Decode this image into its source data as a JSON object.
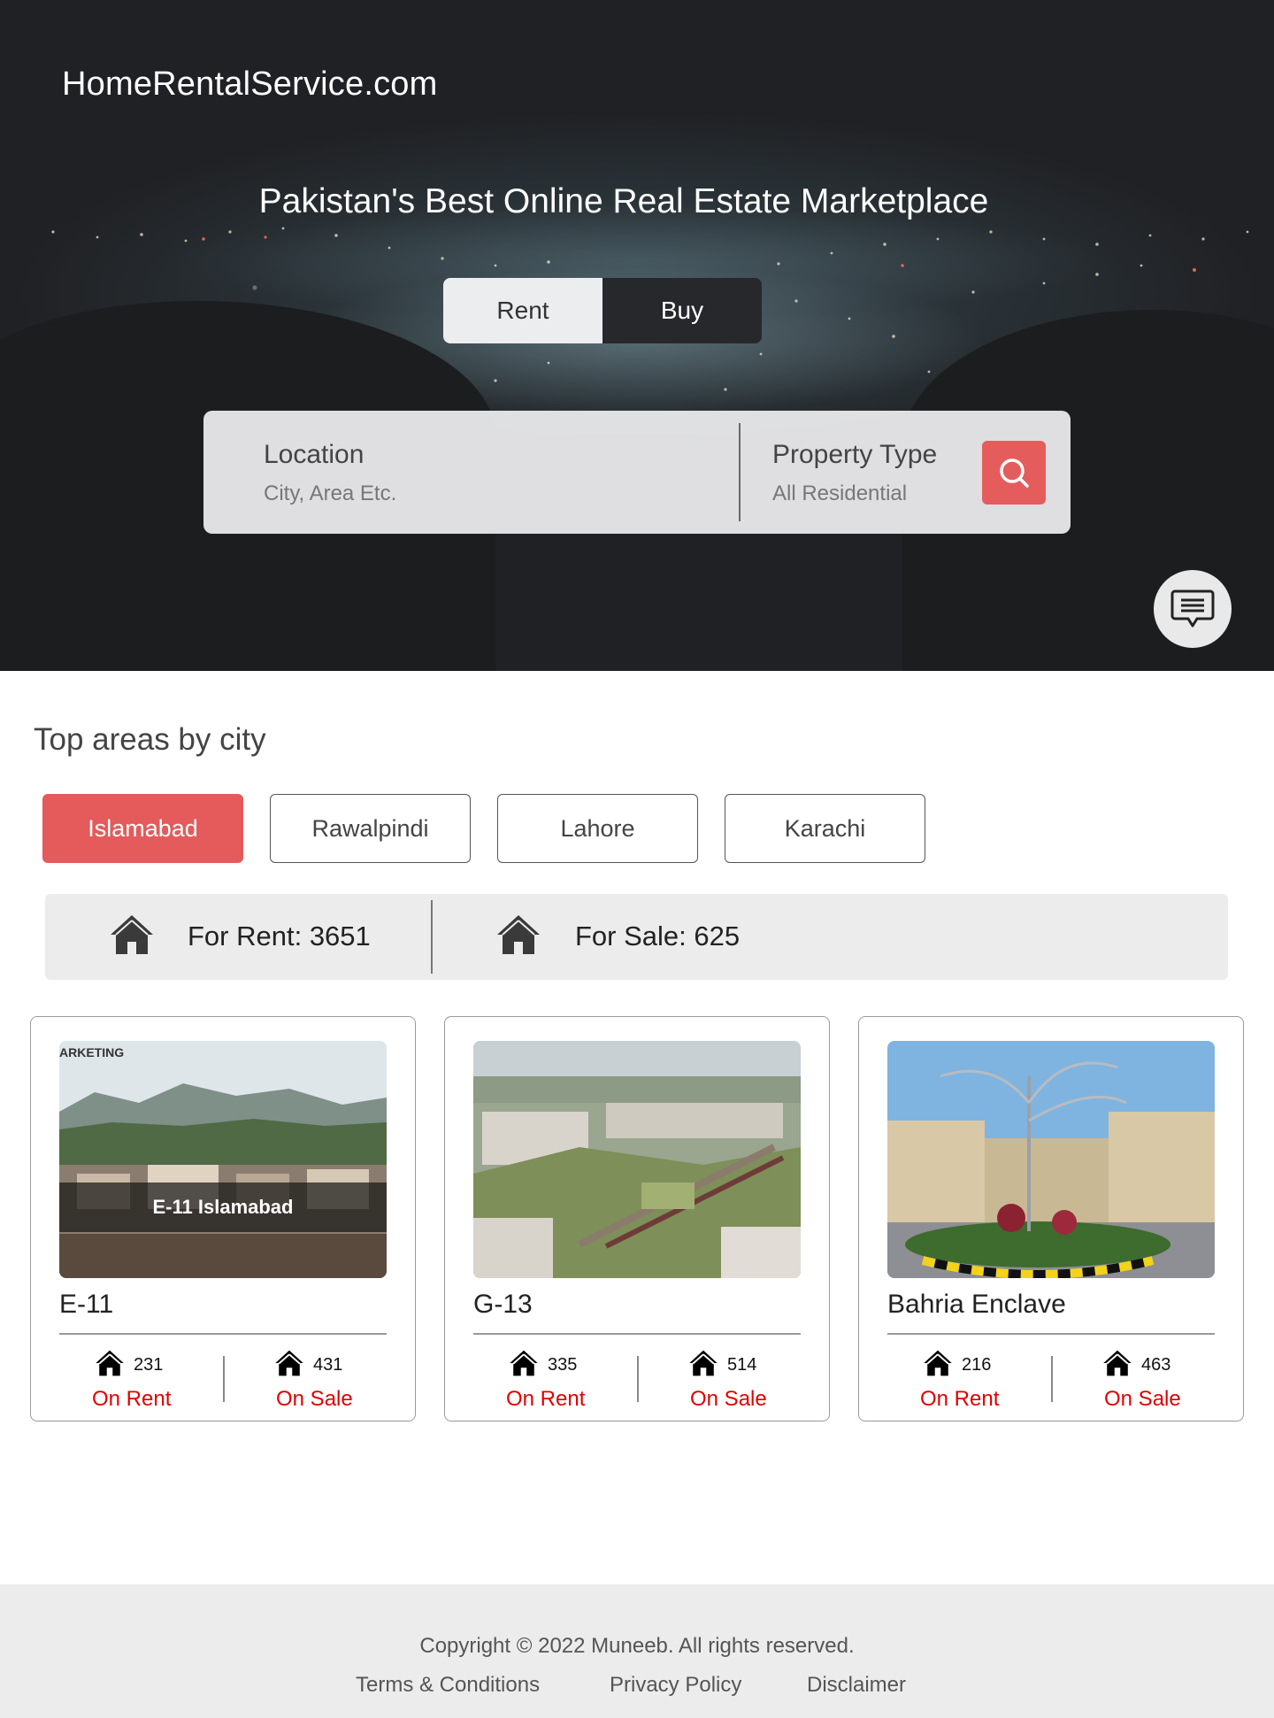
{
  "header": {
    "brand": "HomeRentalService.com",
    "title": "Pakistan's Best Online Real Estate Marketplace"
  },
  "mode_toggle": {
    "options": [
      "Rent",
      "Buy"
    ],
    "selected": "Rent"
  },
  "search": {
    "location_label": "Location",
    "location_placeholder": "City, Area Etc.",
    "type_label": "Property Type",
    "type_value": "All Residential",
    "button_icon": "search-icon"
  },
  "chat": {
    "icon": "chat-icon"
  },
  "areas": {
    "title": "Top areas by city",
    "cities": [
      "Islamabad",
      "Rawalpindi",
      "Lahore",
      "Karachi"
    ],
    "selected_city": "Islamabad",
    "summary": {
      "rent_text": "For Rent: 3651",
      "sale_text": "For Sale: 625"
    },
    "cards": [
      {
        "name": "E-11",
        "image_caption": "E-11 Islamabad",
        "image_corner_text": "ARKETING",
        "rent_count": "231",
        "rent_label": "On Rent",
        "sale_count": "431",
        "sale_label": "On Sale"
      },
      {
        "name": "G-13",
        "rent_count": "335",
        "rent_label": "On Rent",
        "sale_count": "514",
        "sale_label": "On Sale"
      },
      {
        "name": "Bahria Enclave",
        "rent_count": "216",
        "rent_label": "On Rent",
        "sale_count": "463",
        "sale_label": "On Sale"
      }
    ]
  },
  "footer": {
    "copyright": "Copyright © 2022 Muneeb. All rights reserved.",
    "links": [
      "Terms & Conditions",
      "Privacy Policy",
      "Disclaimer"
    ]
  },
  "colors": {
    "accent": "#e55a5a",
    "status_red": "#e00000",
    "hero_bg": "#202124"
  }
}
